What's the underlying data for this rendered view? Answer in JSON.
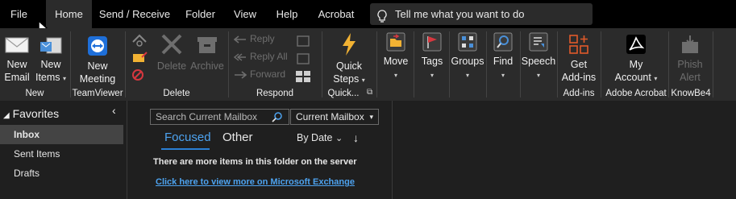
{
  "tabs": [
    {
      "label": "File",
      "active": false
    },
    {
      "label": "Home",
      "active": true
    },
    {
      "label": "Send / Receive",
      "active": false
    },
    {
      "label": "Folder",
      "active": false
    },
    {
      "label": "View",
      "active": false
    },
    {
      "label": "Help",
      "active": false
    },
    {
      "label": "Acrobat",
      "active": false
    }
  ],
  "tellme": {
    "text": "Tell me what you want to do",
    "icon": "lightbulb-icon"
  },
  "ribbon": {
    "new_email": {
      "line1": "New",
      "line2": "Email"
    },
    "new_items": {
      "line1": "New",
      "line2": "Items"
    },
    "new_group": "New",
    "new_meeting": {
      "line1": "New",
      "line2": "Meeting"
    },
    "teamviewer_group": "TeamViewer",
    "delete": "Delete",
    "archive": "Archive",
    "delete_group": "Delete",
    "reply": "Reply",
    "reply_all": "Reply All",
    "forward": "Forward",
    "respond_group": "Respond",
    "quick_steps": {
      "line1": "Quick",
      "line2": "Steps"
    },
    "quick_group": "Quick...",
    "move": "Move",
    "tags": "Tags",
    "groups": "Groups",
    "find": "Find",
    "speech": "Speech",
    "get_addins": {
      "line1": "Get",
      "line2": "Add-ins"
    },
    "addins_group": "Add-ins",
    "my_account": {
      "line1": "My",
      "line2": "Account"
    },
    "acrobat_group": "Adobe Acrobat",
    "phish_alert": {
      "line1": "Phish",
      "line2": "Alert"
    },
    "knowbe4_group": "KnowBe4",
    "colors": {
      "accent": "#4da3f0",
      "addins_orange": "#e05a2b",
      "acrobat_red": "#d7373f",
      "bolt_gold": "#f2b233"
    }
  },
  "sidebar": {
    "favorites": "Favorites",
    "folders": [
      {
        "label": "Inbox",
        "selected": true
      },
      {
        "label": "Sent Items",
        "selected": false
      },
      {
        "label": "Drafts",
        "selected": false
      }
    ]
  },
  "mailbox": {
    "search_placeholder": "Search Current Mailbox",
    "scope": "Current Mailbox",
    "tab_focused": "Focused",
    "tab_other": "Other",
    "sort": "By Date",
    "sort_arrow": "↓",
    "server_msg": "There are more items in this folder on the server",
    "exchange_link": "Click here to view more on Microsoft Exchange"
  }
}
